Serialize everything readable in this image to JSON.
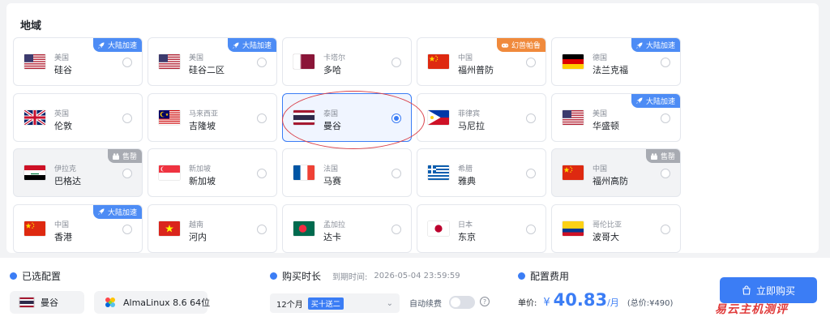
{
  "region": {
    "title": "地域",
    "cards": [
      {
        "country": "美国",
        "city": "硅谷",
        "flag": "us",
        "badge": {
          "type": "blue",
          "icon": "rocket-icon",
          "text": "大陆加速"
        },
        "state": "normal"
      },
      {
        "country": "美国",
        "city": "硅谷二区",
        "flag": "us",
        "badge": {
          "type": "blue",
          "icon": "rocket-icon",
          "text": "大陆加速"
        },
        "state": "normal"
      },
      {
        "country": "卡塔尔",
        "city": "多哈",
        "flag": "qa",
        "badge": null,
        "state": "normal"
      },
      {
        "country": "中国",
        "city": "福州普防",
        "flag": "cn",
        "badge": {
          "type": "orange",
          "icon": "gamepad-icon",
          "text": "幻兽帕鲁"
        },
        "state": "normal"
      },
      {
        "country": "德国",
        "city": "法兰克福",
        "flag": "de",
        "badge": {
          "type": "blue",
          "icon": "rocket-icon",
          "text": "大陆加速"
        },
        "state": "normal"
      },
      {
        "country": "英国",
        "city": "伦敦",
        "flag": "gb",
        "badge": null,
        "state": "normal"
      },
      {
        "country": "马来西亚",
        "city": "吉隆坡",
        "flag": "my",
        "badge": null,
        "state": "normal"
      },
      {
        "country": "泰国",
        "city": "曼谷",
        "flag": "th",
        "badge": null,
        "state": "selected"
      },
      {
        "country": "菲律宾",
        "city": "马尼拉",
        "flag": "ph",
        "badge": null,
        "state": "normal"
      },
      {
        "country": "美国",
        "city": "华盛顿",
        "flag": "us",
        "badge": {
          "type": "blue",
          "icon": "rocket-icon",
          "text": "大陆加速"
        },
        "state": "normal"
      },
      {
        "country": "伊拉克",
        "city": "巴格达",
        "flag": "iq",
        "badge": {
          "type": "gray",
          "icon": "soldout-icon",
          "text": "售罄"
        },
        "state": "soldout"
      },
      {
        "country": "新加坡",
        "city": "新加坡",
        "flag": "sg",
        "badge": null,
        "state": "normal"
      },
      {
        "country": "法国",
        "city": "马赛",
        "flag": "fr",
        "badge": null,
        "state": "normal"
      },
      {
        "country": "希腊",
        "city": "雅典",
        "flag": "gr",
        "badge": null,
        "state": "normal"
      },
      {
        "country": "中国",
        "city": "福州高防",
        "flag": "cn",
        "badge": {
          "type": "gray",
          "icon": "soldout-icon",
          "text": "售罄"
        },
        "state": "soldout"
      },
      {
        "country": "中国",
        "city": "香港",
        "flag": "cn",
        "badge": {
          "type": "blue",
          "icon": "rocket-icon",
          "text": "大陆加速"
        },
        "state": "normal"
      },
      {
        "country": "越南",
        "city": "河内",
        "flag": "vn",
        "badge": null,
        "state": "normal"
      },
      {
        "country": "孟加拉",
        "city": "达卡",
        "flag": "bd",
        "badge": null,
        "state": "normal"
      },
      {
        "country": "日本",
        "city": "东京",
        "flag": "jp",
        "badge": null,
        "state": "normal"
      },
      {
        "country": "哥伦比亚",
        "city": "波哥大",
        "flag": "co",
        "badge": null,
        "state": "normal"
      }
    ]
  },
  "footer": {
    "selected_config": {
      "title": "已选配置",
      "region": "曼谷",
      "os": "AlmaLinux 8.6 64位"
    },
    "duration": {
      "title": "购买时长",
      "expire_label": "到期时间:",
      "expire_value": "2026-05-04 23:59:59",
      "selected": "12个月",
      "promo": "买十送二",
      "auto_renew_label": "自动续费",
      "auto_renew": false,
      "help": "?"
    },
    "cost": {
      "title": "配置费用",
      "unit_label": "单价:",
      "currency": "¥",
      "amount": "40.83",
      "per": "/月",
      "total": "(总价:¥490)"
    },
    "buy_label": "立即购买",
    "watermark": "易云主机测评"
  },
  "colors": {
    "accent": "#3b7df5",
    "badge_blue": "#4d8cf5",
    "badge_orange": "#f08a3c",
    "badge_gray": "#a8abb2",
    "annotation": "#d9414a"
  }
}
